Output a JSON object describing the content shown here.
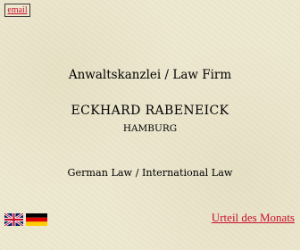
{
  "header": {
    "email_label": "email"
  },
  "main": {
    "kanzlei": "Anwaltskanzlei  /  Law Firm",
    "name": "ECKHARD  RABENEICK",
    "city": "HAMBURG",
    "areas": "German  Law  /  International  Law"
  },
  "footer": {
    "flags": [
      {
        "icon": "uk-flag-icon"
      },
      {
        "icon": "germany-flag-icon"
      }
    ],
    "urteil_label": "Urteil des Monats"
  },
  "colors": {
    "background": "#ede8d0",
    "link": "#c8102e"
  }
}
